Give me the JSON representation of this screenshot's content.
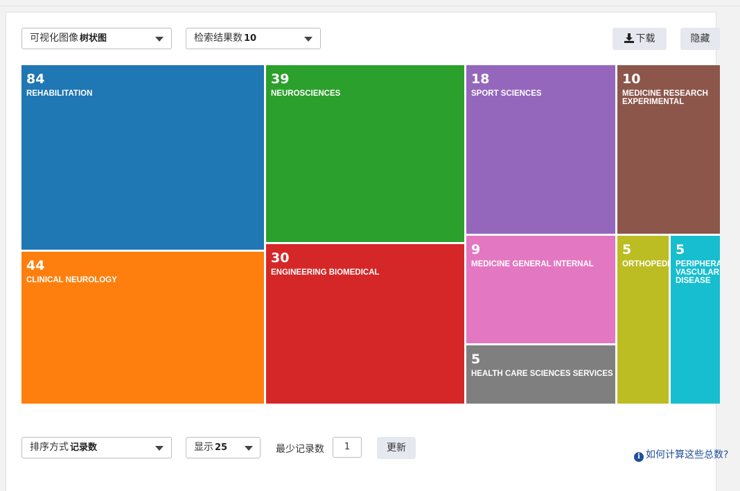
{
  "toolbar": {
    "viz_label": "可视化图像",
    "viz_value": "树状图",
    "results_label": "检索结果数",
    "results_value": "10",
    "download_label": "下载",
    "hide_label": "隐藏"
  },
  "colors": {
    "rehabilitation": "#1f77b4",
    "clinical_neurology": "#ff7f0e",
    "neurosciences": "#2ca02c",
    "engineering_biomedical": "#d62728",
    "sport_sciences": "#9467bd",
    "medicine_general_internal": "#e377c2",
    "health_care": "#7f7f7f",
    "medicine_research": "#8c564b",
    "orthopedics": "#bcbd22",
    "peripheral": "#17becf"
  },
  "chart_data": {
    "type": "treemap",
    "title": "",
    "items": [
      {
        "value": 84,
        "label": "REHABILITATION"
      },
      {
        "value": 44,
        "label": "CLINICAL NEUROLOGY"
      },
      {
        "value": 39,
        "label": "NEUROSCIENCES"
      },
      {
        "value": 30,
        "label": "ENGINEERING BIOMEDICAL"
      },
      {
        "value": 18,
        "label": "SPORT SCIENCES"
      },
      {
        "value": 9,
        "label": "MEDICINE GENERAL INTERNAL"
      },
      {
        "value": 5,
        "label": "HEALTH CARE SCIENCES SERVICES"
      },
      {
        "value": 10,
        "label": "MEDICINE RESEARCH EXPERIMENTAL"
      },
      {
        "value": 5,
        "label": "ORTHOPEDICS"
      },
      {
        "value": 5,
        "label": "PERIPHERAL VASCULAR DISEASE"
      }
    ]
  },
  "footer": {
    "sort_label": "排序方式",
    "sort_value": "记录数",
    "show_label": "显示",
    "show_value": "25",
    "min_records_label": "最少记录数",
    "min_records_value": "1",
    "update_label": "更新",
    "help_link": "如何计算这些总数?"
  }
}
